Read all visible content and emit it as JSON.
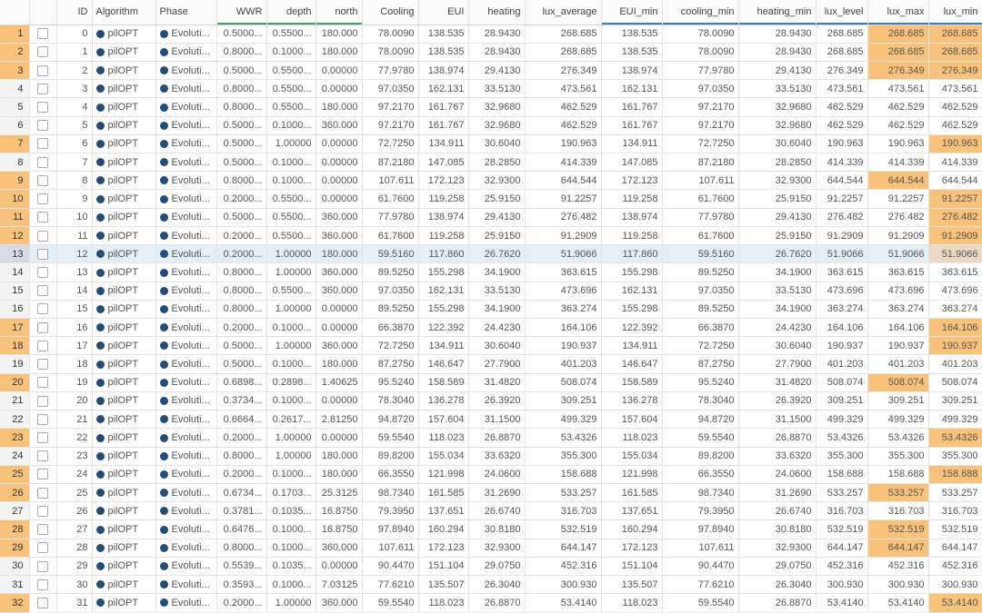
{
  "columns": [
    "",
    "",
    "ID",
    "Algorithm",
    "Phase",
    "WWR",
    "depth",
    "north",
    "Cooling",
    "EUI",
    "heating",
    "lux_average",
    "EUI_min",
    "cooling_min",
    "heating_min",
    "lux_level",
    "lux_max",
    "lux_min"
  ],
  "colors": {
    "row_highlight": "#f8c27a",
    "selected_row": "#e3eef6",
    "series_dot": "#1f4e79"
  },
  "rows": [
    {
      "n": "1",
      "id": "0",
      "alg": "pilOPT",
      "phase": "Evoluti...",
      "wwr": "0.5000...",
      "depth": "0.5500...",
      "north": "180.000",
      "cooling": "78.0090",
      "eui": "138.535",
      "heating": "28.9430",
      "lux_average": "268.685",
      "eui_min": "138.535",
      "cooling_min": "78.0090",
      "heating_min": "28.9430",
      "lux_level": "268.685",
      "lux_max": "268.685",
      "lux_min": "268.685"
    },
    {
      "n": "2",
      "id": "1",
      "alg": "pilOPT",
      "phase": "Evoluti...",
      "wwr": "0.8000...",
      "depth": "0.1000...",
      "north": "180.000",
      "cooling": "78.0090",
      "eui": "138.535",
      "heating": "28.9430",
      "lux_average": "268.685",
      "eui_min": "138.535",
      "cooling_min": "78.0090",
      "heating_min": "28.9430",
      "lux_level": "268.685",
      "lux_max": "268.685",
      "lux_min": "268.685"
    },
    {
      "n": "3",
      "id": "2",
      "alg": "pilOPT",
      "phase": "Evoluti...",
      "wwr": "0.5000...",
      "depth": "0.5500...",
      "north": "0.00000",
      "cooling": "77.9780",
      "eui": "138.974",
      "heating": "29.4130",
      "lux_average": "276.349",
      "eui_min": "138.974",
      "cooling_min": "77.9780",
      "heating_min": "29.4130",
      "lux_level": "276.349",
      "lux_max": "276.349",
      "lux_min": "276.349"
    },
    {
      "n": "4",
      "id": "3",
      "alg": "pilOPT",
      "phase": "Evoluti...",
      "wwr": "0.8000...",
      "depth": "0.5500...",
      "north": "0.00000",
      "cooling": "97.0350",
      "eui": "162.131",
      "heating": "33.5130",
      "lux_average": "473.561",
      "eui_min": "162.131",
      "cooling_min": "97.0350",
      "heating_min": "33.5130",
      "lux_level": "473.561",
      "lux_max": "473.561",
      "lux_min": "473.561"
    },
    {
      "n": "5",
      "id": "4",
      "alg": "pilOPT",
      "phase": "Evoluti...",
      "wwr": "0.8000...",
      "depth": "0.5500...",
      "north": "180.000",
      "cooling": "97.2170",
      "eui": "161.767",
      "heating": "32.9680",
      "lux_average": "462.529",
      "eui_min": "161.767",
      "cooling_min": "97.2170",
      "heating_min": "32.9680",
      "lux_level": "462.529",
      "lux_max": "462.529",
      "lux_min": "462.529"
    },
    {
      "n": "6",
      "id": "5",
      "alg": "pilOPT",
      "phase": "Evoluti...",
      "wwr": "0.5000...",
      "depth": "0.1000...",
      "north": "360.000",
      "cooling": "97.2170",
      "eui": "161.767",
      "heating": "32.9680",
      "lux_average": "462.529",
      "eui_min": "161.767",
      "cooling_min": "97.2170",
      "heating_min": "32.9680",
      "lux_level": "462.529",
      "lux_max": "462.529",
      "lux_min": "462.529"
    },
    {
      "n": "7",
      "id": "6",
      "alg": "pilOPT",
      "phase": "Evoluti...",
      "wwr": "0.5000...",
      "depth": "1.00000",
      "north": "0.00000",
      "cooling": "72.7250",
      "eui": "134.911",
      "heating": "30.6040",
      "lux_average": "190.963",
      "eui_min": "134.911",
      "cooling_min": "72.7250",
      "heating_min": "30.6040",
      "lux_level": "190.963",
      "lux_max": "190.963",
      "lux_min": "190.963"
    },
    {
      "n": "8",
      "id": "7",
      "alg": "pilOPT",
      "phase": "Evoluti...",
      "wwr": "0.5000...",
      "depth": "0.1000...",
      "north": "0.00000",
      "cooling": "87.2180",
      "eui": "147.085",
      "heating": "28.2850",
      "lux_average": "414.339",
      "eui_min": "147.085",
      "cooling_min": "87.2180",
      "heating_min": "28.2850",
      "lux_level": "414.339",
      "lux_max": "414.339",
      "lux_min": "414.339"
    },
    {
      "n": "9",
      "id": "8",
      "alg": "pilOPT",
      "phase": "Evoluti...",
      "wwr": "0.8000...",
      "depth": "0.1000...",
      "north": "0.00000",
      "cooling": "107.611",
      "eui": "172.123",
      "heating": "32.9300",
      "lux_average": "644.544",
      "eui_min": "172.123",
      "cooling_min": "107.611",
      "heating_min": "32.9300",
      "lux_level": "644.544",
      "lux_max": "644.544",
      "lux_min": "644.544"
    },
    {
      "n": "10",
      "id": "9",
      "alg": "pilOPT",
      "phase": "Evoluti...",
      "wwr": "0.2000...",
      "depth": "0.5500...",
      "north": "0.00000",
      "cooling": "61.7600",
      "eui": "119.258",
      "heating": "25.9150",
      "lux_average": "91.2257",
      "eui_min": "119.258",
      "cooling_min": "61.7600",
      "heating_min": "25.9150",
      "lux_level": "91.2257",
      "lux_max": "91.2257",
      "lux_min": "91.2257"
    },
    {
      "n": "11",
      "id": "10",
      "alg": "pilOPT",
      "phase": "Evoluti...",
      "wwr": "0.5000...",
      "depth": "0.5500...",
      "north": "360.000",
      "cooling": "77.9780",
      "eui": "138.974",
      "heating": "29.4130",
      "lux_average": "276.482",
      "eui_min": "138.974",
      "cooling_min": "77.9780",
      "heating_min": "29.4130",
      "lux_level": "276.482",
      "lux_max": "276.482",
      "lux_min": "276.482"
    },
    {
      "n": "12",
      "id": "11",
      "alg": "pilOPT",
      "phase": "Evoluti...",
      "wwr": "0.2000...",
      "depth": "0.5500...",
      "north": "360.000",
      "cooling": "61.7600",
      "eui": "119.258",
      "heating": "25.9150",
      "lux_average": "91.2909",
      "eui_min": "119.258",
      "cooling_min": "61.7600",
      "heating_min": "25.9150",
      "lux_level": "91.2909",
      "lux_max": "91.2909",
      "lux_min": "91.2909"
    },
    {
      "n": "13",
      "id": "12",
      "alg": "pilOPT",
      "phase": "Evoluti...",
      "wwr": "0.2000...",
      "depth": "1.00000",
      "north": "180.000",
      "cooling": "59.5160",
      "eui": "117.860",
      "heating": "26.7620",
      "lux_average": "51.9066",
      "eui_min": "117.860",
      "cooling_min": "59.5160",
      "heating_min": "26.7620",
      "lux_level": "51.9066",
      "lux_max": "51.9066",
      "lux_min": "51.9066"
    },
    {
      "n": "14",
      "id": "13",
      "alg": "pilOPT",
      "phase": "Evoluti...",
      "wwr": "0.8000...",
      "depth": "1.00000",
      "north": "360.000",
      "cooling": "89.5250",
      "eui": "155.298",
      "heating": "34.1900",
      "lux_average": "363.615",
      "eui_min": "155.298",
      "cooling_min": "89.5250",
      "heating_min": "34.1900",
      "lux_level": "363.615",
      "lux_max": "363.615",
      "lux_min": "363.615"
    },
    {
      "n": "15",
      "id": "14",
      "alg": "pilOPT",
      "phase": "Evoluti...",
      "wwr": "0.8000...",
      "depth": "0.5500...",
      "north": "360.000",
      "cooling": "97.0350",
      "eui": "162.131",
      "heating": "33.5130",
      "lux_average": "473.696",
      "eui_min": "162.131",
      "cooling_min": "97.0350",
      "heating_min": "33.5130",
      "lux_level": "473.696",
      "lux_max": "473.696",
      "lux_min": "473.696"
    },
    {
      "n": "16",
      "id": "15",
      "alg": "pilOPT",
      "phase": "Evoluti...",
      "wwr": "0.8000...",
      "depth": "1.00000",
      "north": "0.00000",
      "cooling": "89.5250",
      "eui": "155.298",
      "heating": "34.1900",
      "lux_average": "363.274",
      "eui_min": "155.298",
      "cooling_min": "89.5250",
      "heating_min": "34.1900",
      "lux_level": "363.274",
      "lux_max": "363.274",
      "lux_min": "363.274"
    },
    {
      "n": "17",
      "id": "16",
      "alg": "pilOPT",
      "phase": "Evoluti...",
      "wwr": "0.2000...",
      "depth": "0.1000...",
      "north": "0.00000",
      "cooling": "66.3870",
      "eui": "122.392",
      "heating": "24.4230",
      "lux_average": "164.106",
      "eui_min": "122.392",
      "cooling_min": "66.3870",
      "heating_min": "24.4230",
      "lux_level": "164.106",
      "lux_max": "164.106",
      "lux_min": "164.106"
    },
    {
      "n": "18",
      "id": "17",
      "alg": "pilOPT",
      "phase": "Evoluti...",
      "wwr": "0.5000...",
      "depth": "1.00000",
      "north": "360.000",
      "cooling": "72.7250",
      "eui": "134.911",
      "heating": "30.6040",
      "lux_average": "190.937",
      "eui_min": "134.911",
      "cooling_min": "72.7250",
      "heating_min": "30.6040",
      "lux_level": "190.937",
      "lux_max": "190.937",
      "lux_min": "190.937"
    },
    {
      "n": "19",
      "id": "18",
      "alg": "pilOPT",
      "phase": "Evoluti...",
      "wwr": "0.5000...",
      "depth": "0.1000...",
      "north": "180.000",
      "cooling": "87.2750",
      "eui": "146.647",
      "heating": "27.7900",
      "lux_average": "401.203",
      "eui_min": "146.647",
      "cooling_min": "87.2750",
      "heating_min": "27.7900",
      "lux_level": "401.203",
      "lux_max": "401.203",
      "lux_min": "401.203"
    },
    {
      "n": "20",
      "id": "19",
      "alg": "pilOPT",
      "phase": "Evoluti...",
      "wwr": "0.6898...",
      "depth": "0.2898...",
      "north": "1.40625",
      "cooling": "95.5240",
      "eui": "158.589",
      "heating": "31.4820",
      "lux_average": "508.074",
      "eui_min": "158.589",
      "cooling_min": "95.5240",
      "heating_min": "31.4820",
      "lux_level": "508.074",
      "lux_max": "508.074",
      "lux_min": "508.074"
    },
    {
      "n": "21",
      "id": "20",
      "alg": "pilOPT",
      "phase": "Evoluti...",
      "wwr": "0.3734...",
      "depth": "0.1000...",
      "north": "0.00000",
      "cooling": "78.3040",
      "eui": "136.278",
      "heating": "26.3920",
      "lux_average": "309.251",
      "eui_min": "136.278",
      "cooling_min": "78.3040",
      "heating_min": "26.3920",
      "lux_level": "309.251",
      "lux_max": "309.251",
      "lux_min": "309.251"
    },
    {
      "n": "22",
      "id": "21",
      "alg": "pilOPT",
      "phase": "Evoluti...",
      "wwr": "0.6664...",
      "depth": "0.2617...",
      "north": "2.81250",
      "cooling": "94.8720",
      "eui": "157.604",
      "heating": "31.1500",
      "lux_average": "499.329",
      "eui_min": "157.604",
      "cooling_min": "94.8720",
      "heating_min": "31.1500",
      "lux_level": "499.329",
      "lux_max": "499.329",
      "lux_min": "499.329"
    },
    {
      "n": "23",
      "id": "22",
      "alg": "pilOPT",
      "phase": "Evoluti...",
      "wwr": "0.2000...",
      "depth": "1.00000",
      "north": "0.00000",
      "cooling": "59.5540",
      "eui": "118.023",
      "heating": "26.8870",
      "lux_average": "53.4326",
      "eui_min": "118.023",
      "cooling_min": "59.5540",
      "heating_min": "26.8870",
      "lux_level": "53.4326",
      "lux_max": "53.4326",
      "lux_min": "53.4326"
    },
    {
      "n": "24",
      "id": "23",
      "alg": "pilOPT",
      "phase": "Evoluti...",
      "wwr": "0.8000...",
      "depth": "1.00000",
      "north": "180.000",
      "cooling": "89.8200",
      "eui": "155.034",
      "heating": "33.6320",
      "lux_average": "355.300",
      "eui_min": "155.034",
      "cooling_min": "89.8200",
      "heating_min": "33.6320",
      "lux_level": "355.300",
      "lux_max": "355.300",
      "lux_min": "355.300"
    },
    {
      "n": "25",
      "id": "24",
      "alg": "pilOPT",
      "phase": "Evoluti...",
      "wwr": "0.2000...",
      "depth": "0.1000...",
      "north": "180.000",
      "cooling": "66.3550",
      "eui": "121.998",
      "heating": "24.0600",
      "lux_average": "158.688",
      "eui_min": "121.998",
      "cooling_min": "66.3550",
      "heating_min": "24.0600",
      "lux_level": "158.688",
      "lux_max": "158.688",
      "lux_min": "158.688"
    },
    {
      "n": "26",
      "id": "25",
      "alg": "pilOPT",
      "phase": "Evoluti...",
      "wwr": "0.6734...",
      "depth": "0.1703...",
      "north": "25.3125",
      "cooling": "98.7340",
      "eui": "161.585",
      "heating": "31.2690",
      "lux_average": "533.257",
      "eui_min": "161.585",
      "cooling_min": "98.7340",
      "heating_min": "31.2690",
      "lux_level": "533.257",
      "lux_max": "533.257",
      "lux_min": "533.257"
    },
    {
      "n": "27",
      "id": "26",
      "alg": "pilOPT",
      "phase": "Evoluti...",
      "wwr": "0.3781...",
      "depth": "0.1035...",
      "north": "16.8750",
      "cooling": "79.3950",
      "eui": "137.651",
      "heating": "26.6740",
      "lux_average": "316.703",
      "eui_min": "137.651",
      "cooling_min": "79.3950",
      "heating_min": "26.6740",
      "lux_level": "316.703",
      "lux_max": "316.703",
      "lux_min": "316.703"
    },
    {
      "n": "28",
      "id": "27",
      "alg": "pilOPT",
      "phase": "Evoluti...",
      "wwr": "0.6476...",
      "depth": "0.1000...",
      "north": "16.8750",
      "cooling": "97.8940",
      "eui": "160.294",
      "heating": "30.8180",
      "lux_average": "532.519",
      "eui_min": "160.294",
      "cooling_min": "97.8940",
      "heating_min": "30.8180",
      "lux_level": "532.519",
      "lux_max": "532.519",
      "lux_min": "532.519"
    },
    {
      "n": "29",
      "id": "28",
      "alg": "pilOPT",
      "phase": "Evoluti...",
      "wwr": "0.8000...",
      "depth": "0.1000...",
      "north": "360.000",
      "cooling": "107.611",
      "eui": "172.123",
      "heating": "32.9300",
      "lux_average": "644.147",
      "eui_min": "172.123",
      "cooling_min": "107.611",
      "heating_min": "32.9300",
      "lux_level": "644.147",
      "lux_max": "644.147",
      "lux_min": "644.147"
    },
    {
      "n": "30",
      "id": "29",
      "alg": "pilOPT",
      "phase": "Evoluti...",
      "wwr": "0.5539...",
      "depth": "0.1035...",
      "north": "0.00000",
      "cooling": "90.4470",
      "eui": "151.104",
      "heating": "29.0750",
      "lux_average": "452.316",
      "eui_min": "151.104",
      "cooling_min": "90.4470",
      "heating_min": "29.0750",
      "lux_level": "452.316",
      "lux_max": "452.316",
      "lux_min": "452.316"
    },
    {
      "n": "31",
      "id": "30",
      "alg": "pilOPT",
      "phase": "Evoluti...",
      "wwr": "0.3593...",
      "depth": "0.1000...",
      "north": "7.03125",
      "cooling": "77.6210",
      "eui": "135.507",
      "heating": "26.3040",
      "lux_average": "300.930",
      "eui_min": "135.507",
      "cooling_min": "77.6210",
      "heating_min": "26.3040",
      "lux_level": "300.930",
      "lux_max": "300.930",
      "lux_min": "300.930"
    },
    {
      "n": "32",
      "id": "31",
      "alg": "pilOPT",
      "phase": "Evoluti...",
      "wwr": "0.2000...",
      "depth": "1.00000",
      "north": "360.000",
      "cooling": "59.5540",
      "eui": "118.023",
      "heating": "26.8870",
      "lux_average": "53.4140",
      "eui_min": "118.023",
      "cooling_min": "59.5540",
      "heating_min": "26.8870",
      "lux_level": "53.4140",
      "lux_max": "53.4140",
      "lux_min": "53.4140"
    }
  ],
  "highlighted_rows": [
    "1",
    "2",
    "3",
    "7",
    "9",
    "10",
    "11",
    "12",
    "17",
    "18",
    "20",
    "23",
    "25",
    "26",
    "28",
    "29",
    "32"
  ],
  "selected_row": "13",
  "highlighted_lux_max": [
    "1",
    "2",
    "3",
    "9",
    "20",
    "26",
    "28",
    "29"
  ],
  "highlighted_lux_min": [
    "1",
    "2",
    "3",
    "7",
    "10",
    "11",
    "12",
    "13",
    "17",
    "18",
    "23",
    "25",
    "32"
  ]
}
